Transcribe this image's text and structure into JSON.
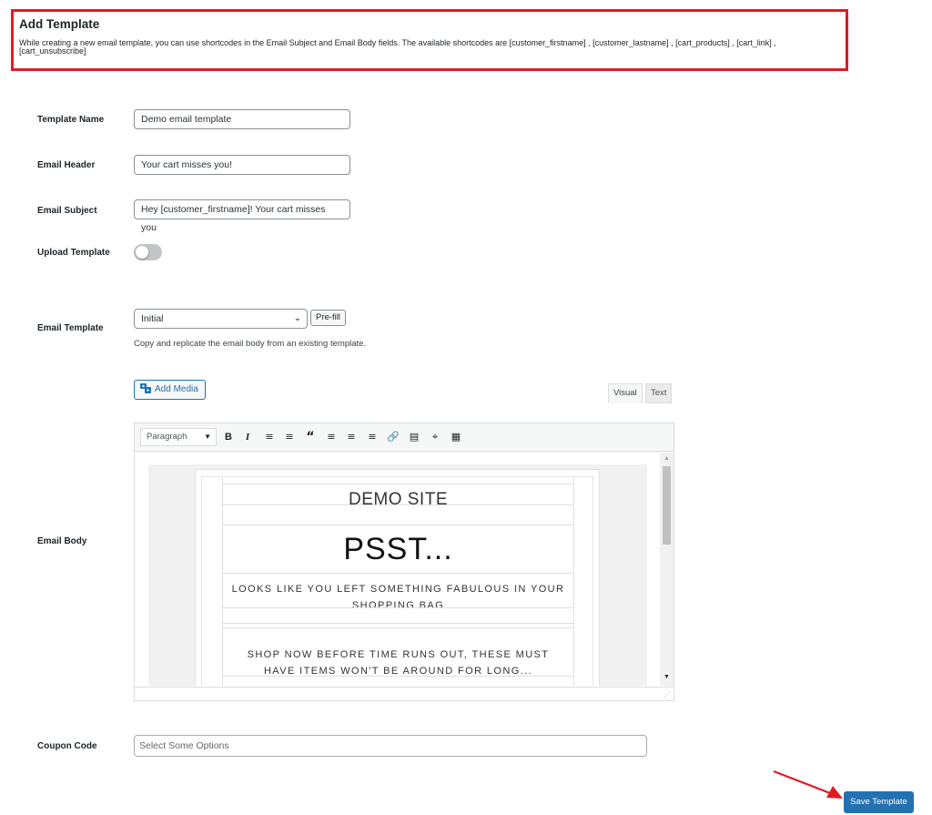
{
  "notice": {
    "title": "Add Template",
    "line1": "While creating a new email template, you can use shortcodes in the Email Subject and Email Body fields. The available shortcodes are [customer_firstname] , [customer_lastname] , [cart_products] , [cart_link] ,",
    "line2": "[cart_unsubscribe]"
  },
  "fields": {
    "template_name": {
      "label": "Template Name",
      "value": "Demo email template"
    },
    "email_header": {
      "label": "Email Header",
      "value": "Your cart misses you!"
    },
    "email_subject": {
      "label": "Email Subject",
      "value": "Hey [customer_firstname]! Your cart misses you"
    },
    "upload_template": {
      "label": "Upload Template",
      "enabled": false
    },
    "email_template": {
      "label": "Email Template",
      "selected": "Initial",
      "prefill_label": "Pre-fill",
      "description": "Copy and replicate the email body from an existing template."
    },
    "email_body": {
      "label": "Email Body"
    },
    "coupon_code": {
      "label": "Coupon Code",
      "placeholder": "Select Some Options"
    }
  },
  "editor": {
    "add_media_label": "Add Media",
    "tabs": {
      "visual": "Visual",
      "text": "Text"
    },
    "format_select": "Paragraph",
    "toolbar_icons": [
      "bold-icon",
      "italic-icon",
      "bullet-list-icon",
      "numbered-list-icon",
      "blockquote-icon",
      "align-left-icon",
      "align-center-icon",
      "align-right-icon",
      "link-icon",
      "read-more-icon",
      "fullscreen-icon",
      "toolbar-toggle-icon"
    ],
    "content": {
      "site_name": "DEMO SITE",
      "headline": "PSST...",
      "message": "LOOKS LIKE YOU LEFT SOMETHING FABULOUS IN YOUR SHOPPING BAG",
      "cta": "SHOP NOW BEFORE TIME RUNS OUT, THESE MUST HAVE ITEMS WON'T BE AROUND FOR LONG..."
    }
  },
  "actions": {
    "save_label": "Save Template"
  },
  "colors": {
    "highlight": "#e01b24",
    "primary": "#2271b1"
  }
}
